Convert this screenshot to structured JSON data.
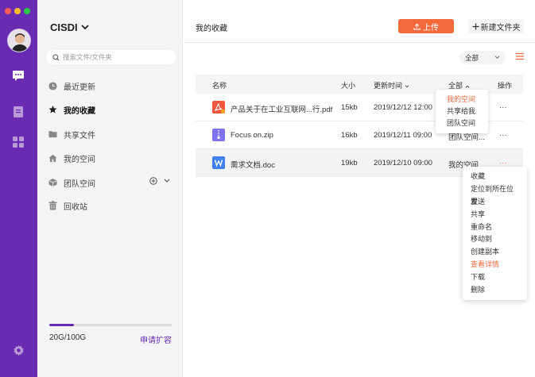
{
  "window": {
    "controls": [
      "#fe5f57",
      "#febc2e",
      "#28c840"
    ]
  },
  "rail": {
    "icons": [
      "chat-icon",
      "document-icon",
      "apps-icon",
      "settings-icon"
    ],
    "accent": "#6a2bb3"
  },
  "sidebar": {
    "brand": "CISDI",
    "search_placeholder": "搜索文件/文件夹",
    "items": [
      {
        "label": "最近更新",
        "icon": "clock-icon"
      },
      {
        "label": "我的收藏",
        "icon": "star-icon"
      },
      {
        "label": "共享文件",
        "icon": "folder-icon"
      },
      {
        "label": "我的空间",
        "icon": "home-icon"
      },
      {
        "label": "团队空间",
        "icon": "cube-icon"
      },
      {
        "label": "回收站",
        "icon": "trash-icon"
      }
    ],
    "storage": {
      "used_text": "20G/100G",
      "used_fraction": 0.2,
      "expand_label": "申请扩容"
    }
  },
  "main": {
    "title": "我的收藏",
    "upload_label": "上传",
    "newfolder_label": "新建文件夹",
    "filter": {
      "selected": "全部"
    },
    "table": {
      "headers": {
        "name": "名称",
        "size": "大小",
        "updated": "更新时间",
        "space": "全部",
        "ops": "操作"
      },
      "rows": [
        {
          "name": "产品关于在工业互联网...行.pdf",
          "size": "15kb",
          "updated": "2019/12/12 12:00",
          "space": "",
          "ops": "···"
        },
        {
          "name": "Focus on.zip",
          "size": "16kb",
          "updated": "2019/12/11  09:00",
          "space": "团队空间...",
          "ops": "···"
        },
        {
          "name": "需求文档.doc",
          "size": "19kb",
          "updated": "2019/12/10  09:00",
          "space": "我的空间",
          "ops": "···"
        }
      ]
    },
    "space_menu": [
      "我的空间",
      "共享给我",
      "团队空间"
    ],
    "ops_menu": [
      "收藏",
      "定位到所在位置",
      "发送",
      "共享",
      "重命名",
      "移动到",
      "创建副本",
      "查看详情",
      "下载",
      "删除"
    ]
  }
}
